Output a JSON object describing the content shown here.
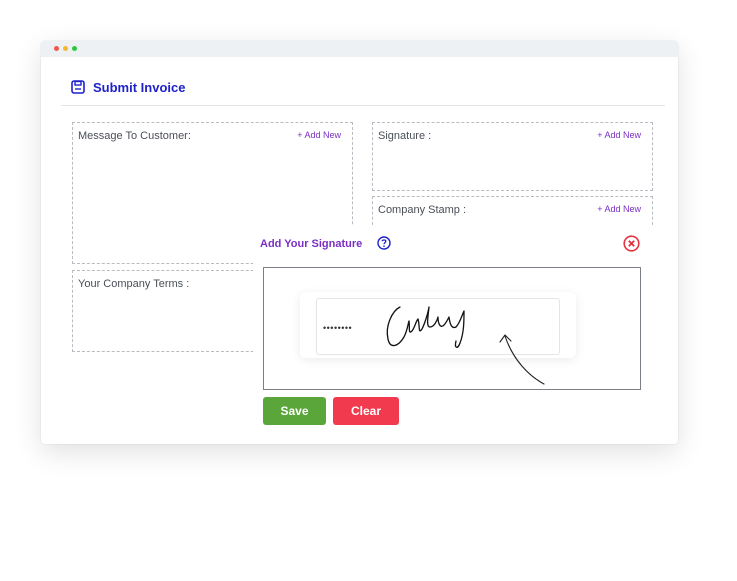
{
  "header": {
    "title": "Submit Invoice"
  },
  "boxes": {
    "message": {
      "label": "Message To Customer:",
      "add": "+ Add New"
    },
    "signature": {
      "label": "Signature :",
      "add": "+ Add New"
    },
    "stamp": {
      "label": "Company Stamp :",
      "add": "+ Add New"
    },
    "terms": {
      "label": "Your Company Terms :"
    }
  },
  "modal": {
    "title": "Add Your Signature",
    "password_mask": "••••••••",
    "save_label": "Save",
    "clear_label": "Clear"
  },
  "colors": {
    "accent_blue": "#1e22c9",
    "accent_purple": "#7a2fc4",
    "save_green": "#5aa63a",
    "clear_red": "#f23a4f",
    "close_red": "#e5323f"
  },
  "icons": [
    "save-icon",
    "help-icon",
    "close-icon"
  ]
}
